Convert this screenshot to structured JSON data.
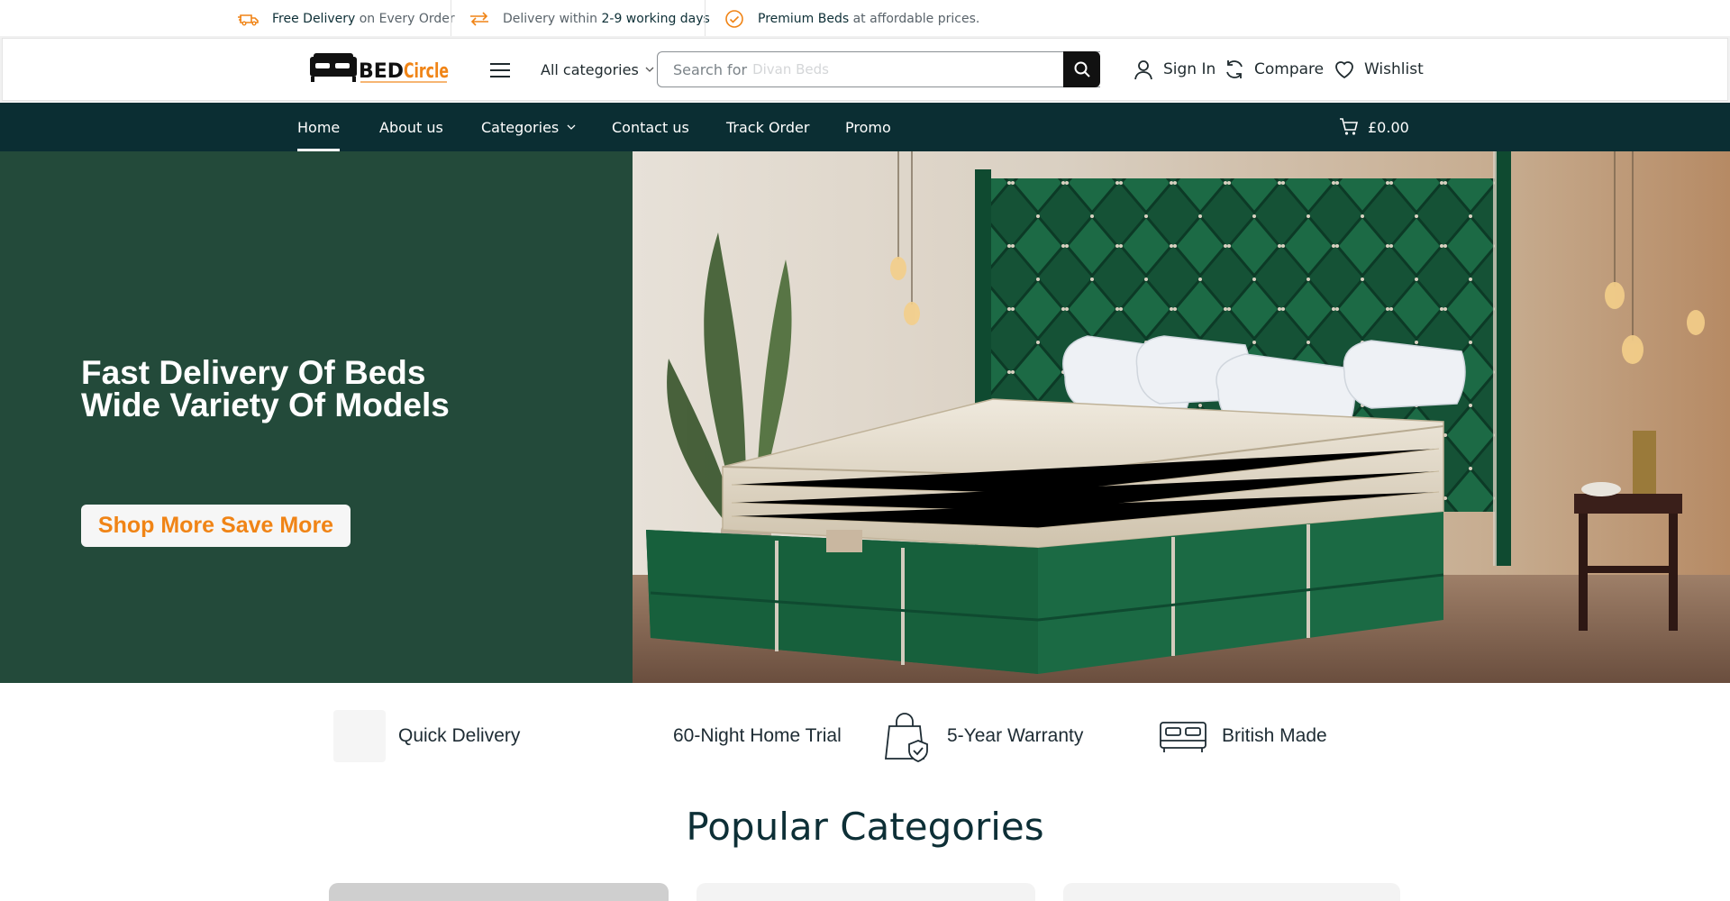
{
  "topbar": {
    "items": [
      {
        "strong": "Free Delivery",
        "rest": " on Every Order",
        "icon": "truck-icon"
      },
      {
        "pre": "Delivery within ",
        "strong": "2-9 working days",
        "icon": "exchange-arrows-icon"
      },
      {
        "strong": "Premium Beds",
        "rest": " at affordable prices.",
        "icon": "check-circle-icon"
      }
    ]
  },
  "header": {
    "logo_text_1": "BED",
    "logo_text_2": "Circle",
    "all_categories": "All categories",
    "search_placeholder": "Search for",
    "search_ghost": "Divan Beds",
    "sign_in": "Sign In",
    "compare": "Compare",
    "wishlist": "Wishlist"
  },
  "nav": {
    "items": [
      "Home",
      "About us",
      "Categories",
      "Contact us",
      "Track Order",
      "Promo"
    ],
    "active": "Home",
    "cart_total": "£0.00"
  },
  "hero": {
    "title_line1": "Fast Delivery Of Beds",
    "title_line2": "Wide Variety Of Models",
    "button": "Shop More Save More"
  },
  "features": [
    "Quick Delivery",
    "60-Night Home Trial",
    "5-Year Warranty",
    "British Made"
  ],
  "section": {
    "title": "Popular Categories"
  },
  "colors": {
    "nav_bg": "#0b2e33",
    "hero_bg": "#234a3a",
    "accent_orange": "#f08416",
    "headboard_green": "#17553a"
  }
}
